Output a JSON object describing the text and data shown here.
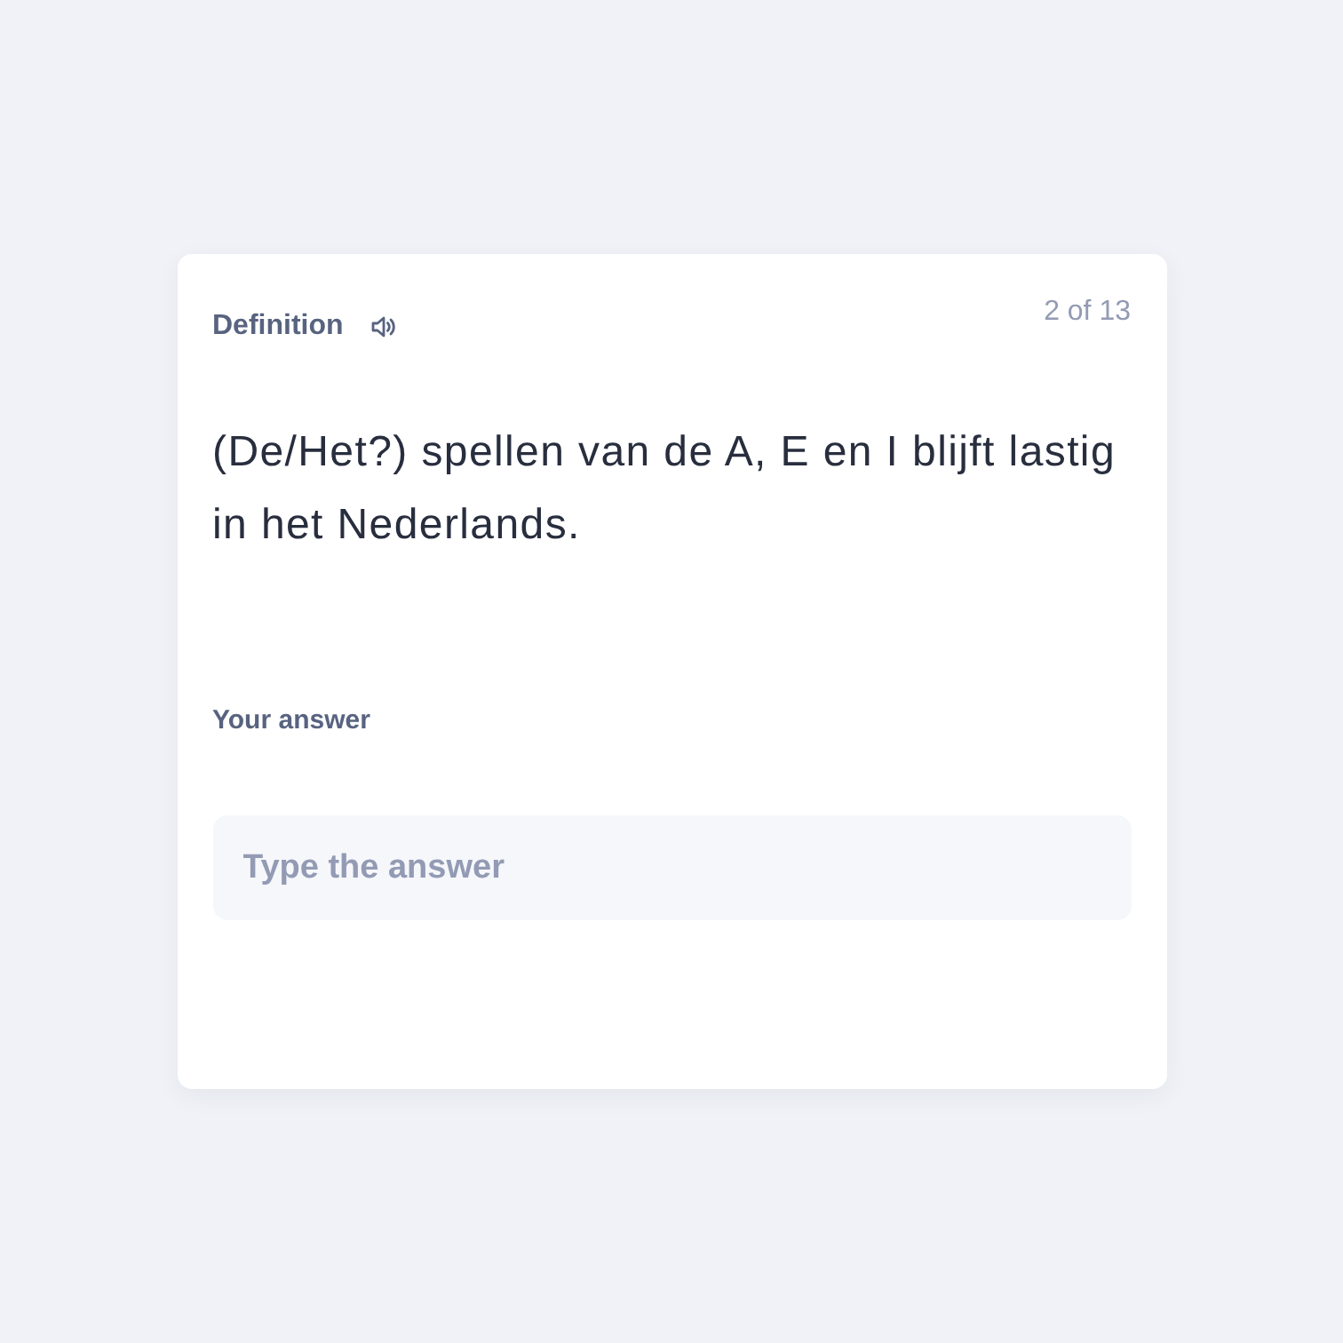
{
  "card": {
    "label": "Definition",
    "counter": "2 of 13",
    "prompt": "(De/Het?) spellen van de A, E en I blijft lastig in het Nederlands."
  },
  "answer": {
    "label": "Your answer",
    "placeholder": "Type the answer"
  }
}
